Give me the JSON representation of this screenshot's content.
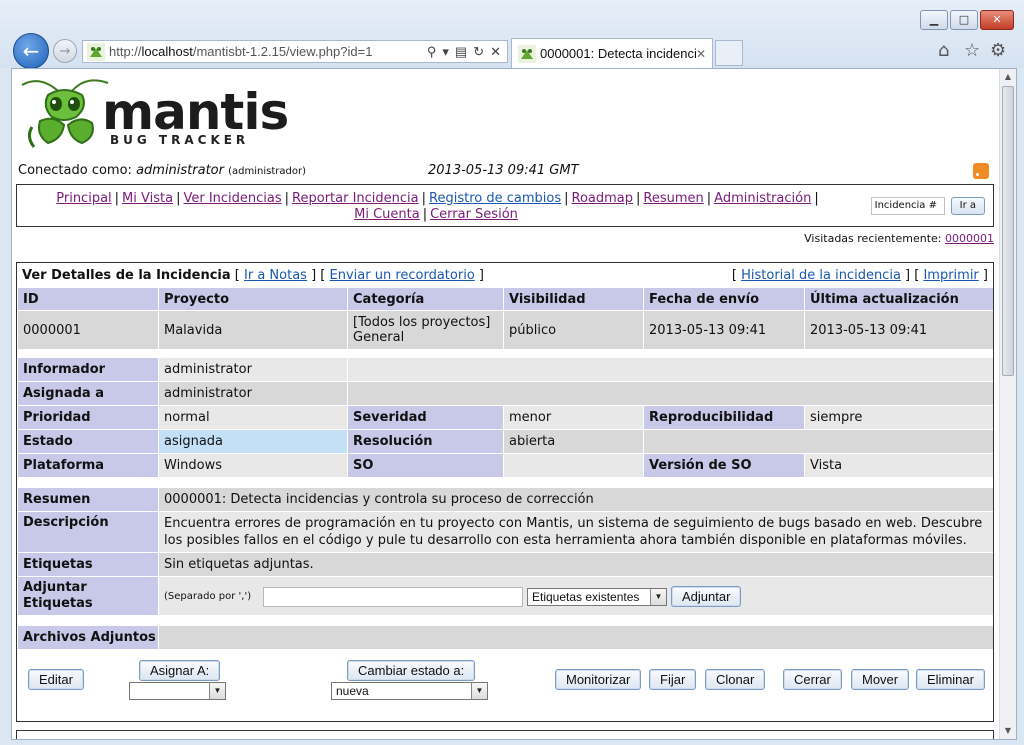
{
  "browser": {
    "url_prefix": "http://",
    "url_host": "localhost",
    "url_path": "/mantisbt-1.2.15/view.php?id=1",
    "tab_title": "0000001: Detecta incidenci...",
    "tab_close": "✕"
  },
  "header": {
    "logo_main": "mantis",
    "logo_sub": "BUG TRACKER",
    "login_prefix": "Conectado como:",
    "login_user": "administrator",
    "login_role": "(administrador)",
    "datetime": "2013-05-13 09:41 GMT"
  },
  "menu": {
    "items": [
      "Principal",
      "Mi Vista",
      "Ver Incidencias",
      "Reportar Incidencia",
      "Registro de cambios",
      "Roadmap",
      "Resumen",
      "Administración",
      "Mi Cuenta",
      "Cerrar Sesión"
    ],
    "separator": "|",
    "jump_placeholder": "Incidencia #",
    "jump_button": "Ir a"
  },
  "recent": {
    "label": "Visitadas recientemente:",
    "link": "0000001"
  },
  "details": {
    "title": "Ver Detalles de la Incidencia",
    "link_notes": "Ir a Notas",
    "link_reminder": "Enviar un recordatorio",
    "link_history": "Historial de la incidencia",
    "link_print": "Imprimir",
    "headers": [
      "ID",
      "Proyecto",
      "Categoría",
      "Visibilidad",
      "Fecha de envío",
      "Última actualización"
    ],
    "values": {
      "id": "0000001",
      "project": "Malavida",
      "category_line1": "[Todos los proyectos]",
      "category_line2": "General",
      "visibility": "público",
      "submitted": "2013-05-13 09:41",
      "updated": "2013-05-13 09:41"
    },
    "labels": {
      "reporter": "Informador",
      "assigned": "Asignada a",
      "priority": "Prioridad",
      "severity": "Severidad",
      "reproducibility": "Reproducibilidad",
      "status": "Estado",
      "resolution": "Resolución",
      "platform": "Plataforma",
      "os": "SO",
      "os_version": "Versión de SO",
      "summary": "Resumen",
      "description": "Descripción",
      "tags": "Etiquetas",
      "attach_tags_1": "Adjuntar",
      "attach_tags_2": "Etiquetas",
      "attachments": "Archivos Adjuntos"
    },
    "fields": {
      "reporter": "administrator",
      "assigned": "administrator",
      "priority": "normal",
      "severity": "menor",
      "reproducibility": "siempre",
      "status": "asignada",
      "resolution": "abierta",
      "platform": "Windows",
      "os": "",
      "os_version": "Vista",
      "summary": "0000001: Detecta incidencias y controla su proceso de corrección",
      "description_line1": "Encuentra errores de programación en tu proyecto con Mantis, un sistema de seguimiento de bugs basado en web. Descubre",
      "description_line2": "los posibles fallos en el código y pule tu desarrollo con esta herramienta ahora también disponible en plataformas móviles.",
      "tags": "Sin etiquetas adjuntas.",
      "tag_hint": "(Separado por ',')",
      "tag_input": "",
      "existing_tags": "Etiquetas existentes",
      "attach_button": "Adjuntar"
    }
  },
  "actions": {
    "edit": "Editar",
    "assign": "Asignar A:",
    "assign_value": "",
    "change_status": "Cambiar estado a:",
    "status_value": "nueva",
    "monitor": "Monitorizar",
    "stick": "Fijar",
    "clone": "Clonar",
    "close": "Cerrar",
    "move": "Mover",
    "delete": "Eliminar"
  },
  "colors": {
    "label_bg": "#c8c8e8",
    "row_dark": "#d8d8d8",
    "row_light": "#e8e8e8",
    "status_assigned": "#c4e0f7",
    "visited_link": "#7a1b7a",
    "link": "#1a58b0"
  }
}
